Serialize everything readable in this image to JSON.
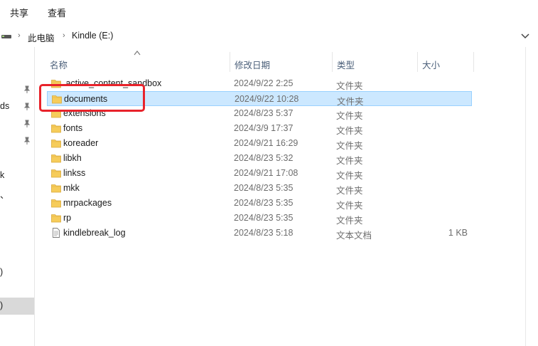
{
  "ribbon": {
    "tabs": [
      "共享",
      "查看"
    ]
  },
  "address": {
    "crumbs": [
      "此电脑",
      "Kindle (E:)"
    ]
  },
  "navpane": {
    "fragments": [
      "ds",
      "k",
      "、",
      ")",
      ")"
    ]
  },
  "columns": {
    "name": "名称",
    "date": "修改日期",
    "type": "类型",
    "size": "大小"
  },
  "files": [
    {
      "name": ".active_content_sandbox",
      "date": "2024/9/22 2:25",
      "type": "文件夹",
      "size": "",
      "icon": "folder-icon"
    },
    {
      "name": "documents",
      "date": "2024/9/22 10:28",
      "type": "文件夹",
      "size": "",
      "icon": "folder-icon",
      "selected": true
    },
    {
      "name": "extensions",
      "date": "2024/8/23 5:37",
      "type": "文件夹",
      "size": "",
      "icon": "folder-icon"
    },
    {
      "name": "fonts",
      "date": "2024/3/9 17:37",
      "type": "文件夹",
      "size": "",
      "icon": "folder-icon"
    },
    {
      "name": "koreader",
      "date": "2024/9/21 16:29",
      "type": "文件夹",
      "size": "",
      "icon": "folder-icon"
    },
    {
      "name": "libkh",
      "date": "2024/8/23 5:32",
      "type": "文件夹",
      "size": "",
      "icon": "folder-icon"
    },
    {
      "name": "linkss",
      "date": "2024/9/21 17:08",
      "type": "文件夹",
      "size": "",
      "icon": "folder-icon"
    },
    {
      "name": "mkk",
      "date": "2024/8/23 5:35",
      "type": "文件夹",
      "size": "",
      "icon": "folder-icon"
    },
    {
      "name": "mrpackages",
      "date": "2024/8/23 5:35",
      "type": "文件夹",
      "size": "",
      "icon": "folder-icon"
    },
    {
      "name": "rp",
      "date": "2024/8/23 5:35",
      "type": "文件夹",
      "size": "",
      "icon": "folder-icon"
    },
    {
      "name": "kindlebreak_log",
      "date": "2024/8/23 5:18",
      "type": "文本文档",
      "size": "1 KB",
      "icon": "text-file-icon"
    }
  ],
  "colors": {
    "selection": "#cce8ff",
    "selection_border": "#99d1ff",
    "highlight": "#e8232b",
    "folder": "#f6cc5a"
  }
}
